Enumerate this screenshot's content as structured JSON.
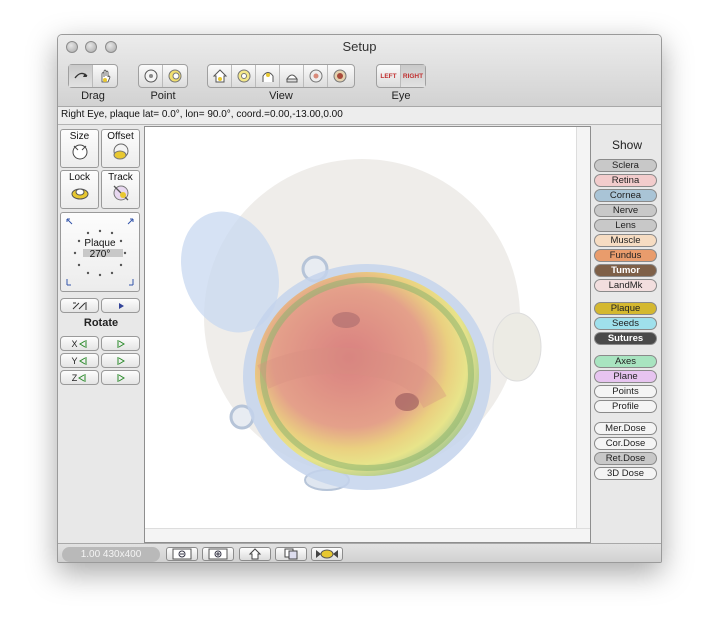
{
  "window": {
    "title": "Setup"
  },
  "toolbar": {
    "drag_label": "Drag",
    "point_label": "Point",
    "view_label": "View",
    "eye_label": "Eye",
    "eye_left": "LEFT",
    "eye_right": "RIGHT",
    "drag_icons": [
      "rotate-drag-icon",
      "hand-drag-icon"
    ],
    "point_icons": [
      "point-target-icon",
      "point-ring-icon"
    ],
    "view_icons": [
      "view-home-icon",
      "view-top-icon",
      "view-side-icon",
      "view-front-icon",
      "view-eye-icon",
      "view-center-icon"
    ]
  },
  "status": {
    "text": "Right Eye, plaque lat=  0.0°, lon= 90.0°, coord.=0.00,-13.00,0.00"
  },
  "left_panel": {
    "size_label": "Size",
    "offset_label": "Offset",
    "lock_label": "Lock",
    "track_label": "Track",
    "plaque_label": "Plaque",
    "plaque_angle": "270°",
    "rotate_label": "Rotate",
    "x_label": "X",
    "y_label": "Y",
    "z_label": "Z"
  },
  "right_panel": {
    "show_label": "Show",
    "group1": [
      {
        "label": "Sclera",
        "color": "#c8c8c8"
      },
      {
        "label": "Retina",
        "color": "#f2cccc"
      },
      {
        "label": "Cornea",
        "color": "#a9c4d6"
      },
      {
        "label": "Nerve",
        "color": "#c8c8c8"
      },
      {
        "label": "Lens",
        "color": "#c8c8c8"
      },
      {
        "label": "Muscle",
        "color": "#f6dcc2"
      },
      {
        "label": "Fundus",
        "color": "#e99c6c"
      },
      {
        "label": "Tumor",
        "color": "#7e6048"
      },
      {
        "label": "LandMk",
        "color": "#f2dede"
      }
    ],
    "group2": [
      {
        "label": "Plaque",
        "color": "#d4b830"
      },
      {
        "label": "Seeds",
        "color": "#9fe0ec"
      },
      {
        "label": "Sutures",
        "color": "#4a4a4a"
      }
    ],
    "group3": [
      {
        "label": "Axes",
        "color": "#a8e4c0"
      },
      {
        "label": "Plane",
        "color": "#e7c4f0"
      },
      {
        "label": "Points",
        "color": "#f4f4f4"
      },
      {
        "label": "Profile",
        "color": "#f4f4f4"
      }
    ],
    "group4": [
      {
        "label": "Mer.Dose",
        "color": "#f4f4f4"
      },
      {
        "label": "Cor.Dose",
        "color": "#f4f4f4"
      },
      {
        "label": "Ret.Dose",
        "color": "#c8c8c8"
      },
      {
        "label": "3D Dose",
        "color": "#f4f4f4"
      }
    ]
  },
  "bottom": {
    "zoom_text": "1.00 430x400",
    "buttons": [
      "zoom-out-icon",
      "zoom-in-icon",
      "home-icon",
      "copy-icon",
      "candy-icon"
    ]
  }
}
